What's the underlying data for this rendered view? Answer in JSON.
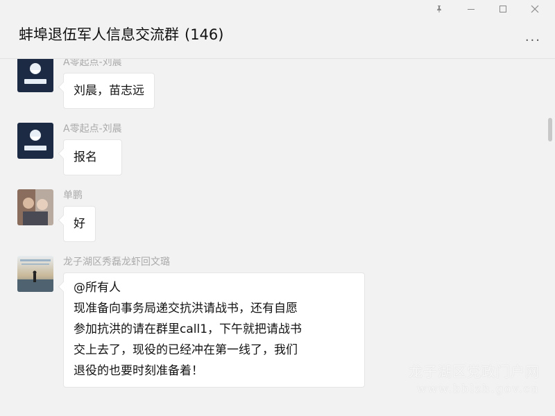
{
  "window": {
    "controls": [
      {
        "icon": "pin-icon"
      },
      {
        "icon": "minimize-icon"
      },
      {
        "icon": "maximize-icon"
      },
      {
        "icon": "close-icon"
      }
    ]
  },
  "header": {
    "title": "蚌埠退伍军人信息交流群",
    "member_count": "(146)",
    "more_label": "···"
  },
  "messages": [
    {
      "sender": "A零起点-刘晨",
      "avatar": "logo-avatar",
      "lines": [
        "刘晨，苗志远"
      ]
    },
    {
      "sender": "A零起点-刘晨",
      "avatar": "logo-avatar",
      "lines": [
        "报名"
      ]
    },
    {
      "sender": "单鹏",
      "avatar": "photo-avatar",
      "lines": [
        "好"
      ]
    },
    {
      "sender": "龙子湖区秀磊龙虾回文璐",
      "avatar": "beach-avatar",
      "lines": [
        "@所有人",
        "现准备向事务局递交抗洪请战书，还有自愿",
        "参加抗洪的请在群里call1，下午就把请战书",
        "交上去了，现役的已经冲在第一线了，我们",
        "退役的也要时刻准备着！"
      ]
    }
  ],
  "watermark": {
    "line1": "龙子湖区党政门户网",
    "line2": "www.bblzh.gov.cn"
  },
  "colors": {
    "background": "#f2f2f2",
    "bubble": "#ffffff",
    "sender": "#aaaaaa"
  }
}
